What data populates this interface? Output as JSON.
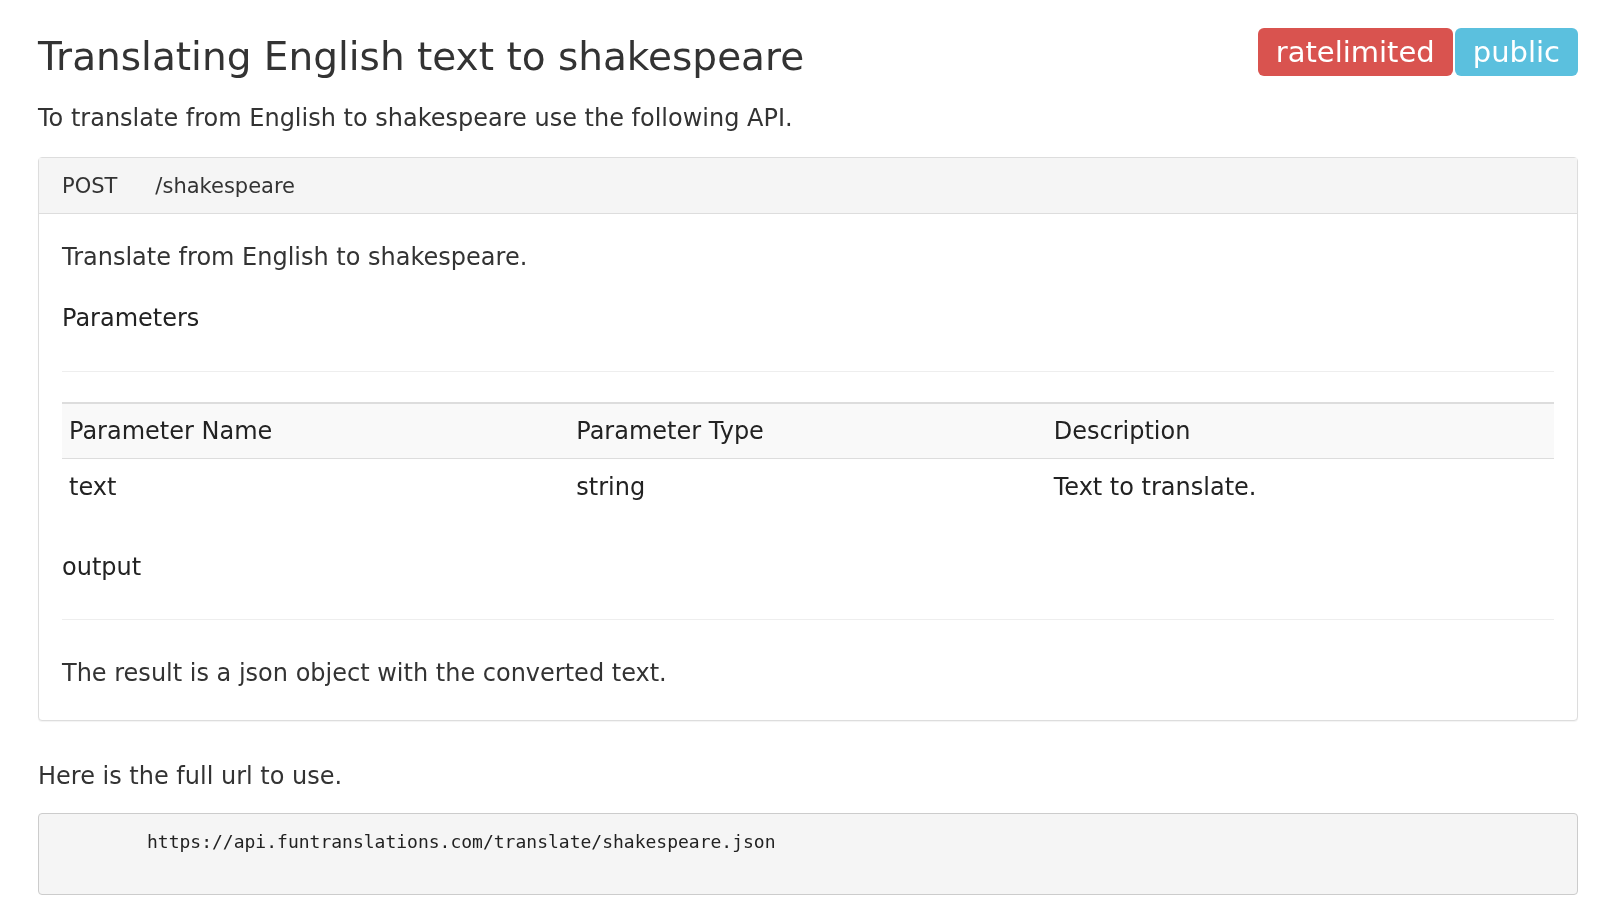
{
  "header": {
    "title": "Translating English text to shakespeare",
    "badges": [
      {
        "label": "ratelimited",
        "color": "#d9534f"
      },
      {
        "label": "public",
        "color": "#5bc0de"
      }
    ]
  },
  "intro": "To translate from English to shakespeare use the following API.",
  "endpoint": {
    "method": "POST",
    "path": "/shakespeare",
    "description": "Translate from English to shakespeare.",
    "parameters_heading": "Parameters",
    "table": {
      "columns": [
        "Parameter Name",
        "Parameter Type",
        "Description"
      ],
      "rows": [
        [
          "text",
          "string",
          "Text to translate."
        ]
      ]
    },
    "output_heading": "output",
    "output_text": "The result is a json object with the converted text."
  },
  "url_intro": "Here is the full url to use.",
  "url": "https://api.funtranslations.com/translate/shakespeare.json"
}
